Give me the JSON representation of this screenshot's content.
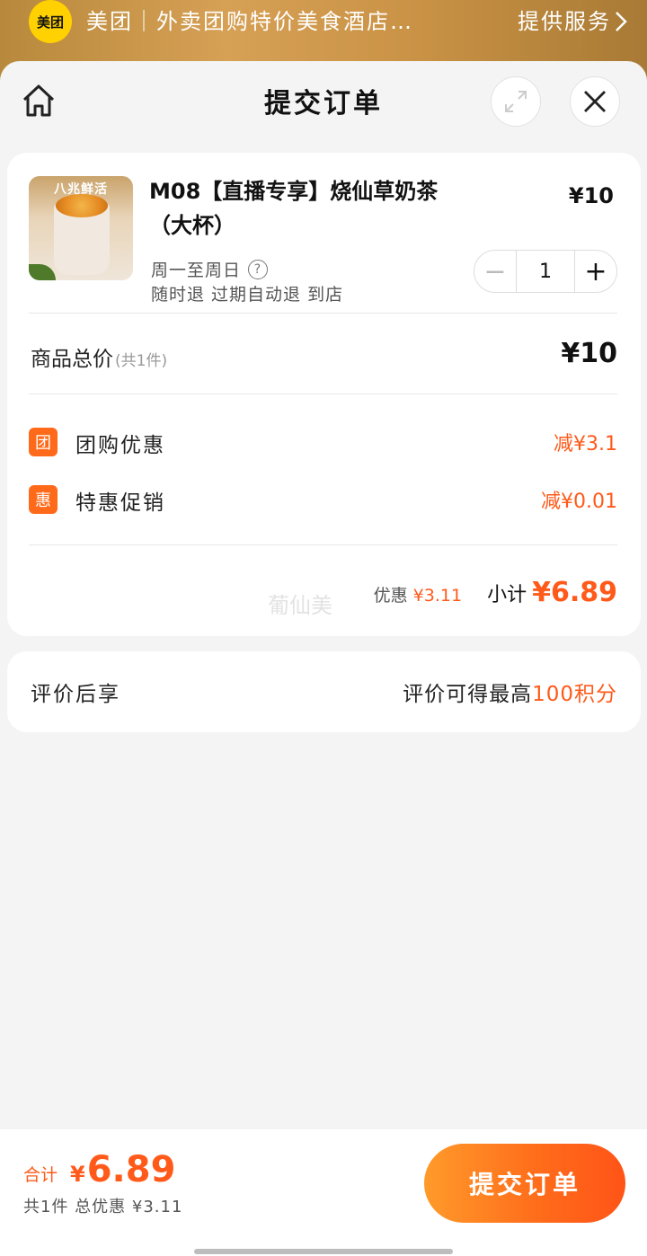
{
  "banner": {
    "logo_text": "美团",
    "title": "美团｜外卖团购特价美食酒店…",
    "provider": "提供服务"
  },
  "header": {
    "title": "提交订单"
  },
  "product": {
    "name": "M08【直播专享】烧仙草奶茶（大杯）",
    "price": "¥10",
    "validity": "周一至周日",
    "refund_policy": "随时退 过期自动退 到店",
    "quantity": "1",
    "thumbnail_brand_text": "八兆鲜活"
  },
  "totals": {
    "label": "商品总价",
    "count_text": "(共1件)",
    "price": "¥10"
  },
  "promotions": [
    {
      "badge": "团",
      "label": "团购优惠",
      "value": "减¥3.1"
    },
    {
      "badge": "惠",
      "label": "特惠促销",
      "value": "减¥0.01"
    }
  ],
  "summary": {
    "watermark": "葡仙美",
    "discount_label": "优惠",
    "discount_value": "¥3.11",
    "subtotal_label": "小计",
    "subtotal_value": "¥6.89"
  },
  "review": {
    "left": "评价后享",
    "right_prefix": "评价可得最高",
    "right_highlight": "100积分"
  },
  "bottom": {
    "grand_label": "合计",
    "currency": "¥",
    "grand_value": "6.89",
    "sub_text": "共1件 总优惠 ¥3.11",
    "submit_label": "提交订单"
  },
  "colors": {
    "accent": "#ff5a1a",
    "brand_yellow": "#ffd100"
  }
}
